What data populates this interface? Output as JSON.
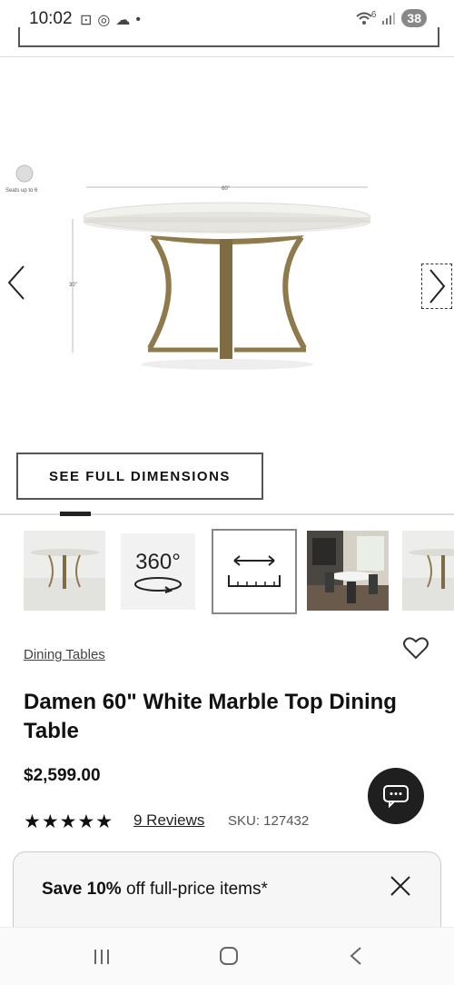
{
  "status": {
    "time": "10:02",
    "battery": "38",
    "signal_badge": "6"
  },
  "hero": {
    "seats_label": "Seats up to 6",
    "width_label": "60\"",
    "height_label": "30\""
  },
  "dimensions_button": {
    "label": "SEE FULL DIMENSIONS"
  },
  "thumbnails": {
    "spin_label": "360°"
  },
  "product": {
    "breadcrumb": "Dining Tables",
    "title": "Damen 60\" White Marble Top Dining Table",
    "price": "$2,599.00",
    "stars": "★★★★★",
    "rating": 5,
    "reviews": "9 Reviews",
    "sku": "SKU: 127432"
  },
  "promo": {
    "bold": "Save 10%",
    "rest": " off full-price items*"
  },
  "colors": {
    "accent": "#1f1f1f",
    "brass": "#8f7a4c",
    "marble": "#f1f1ee"
  }
}
